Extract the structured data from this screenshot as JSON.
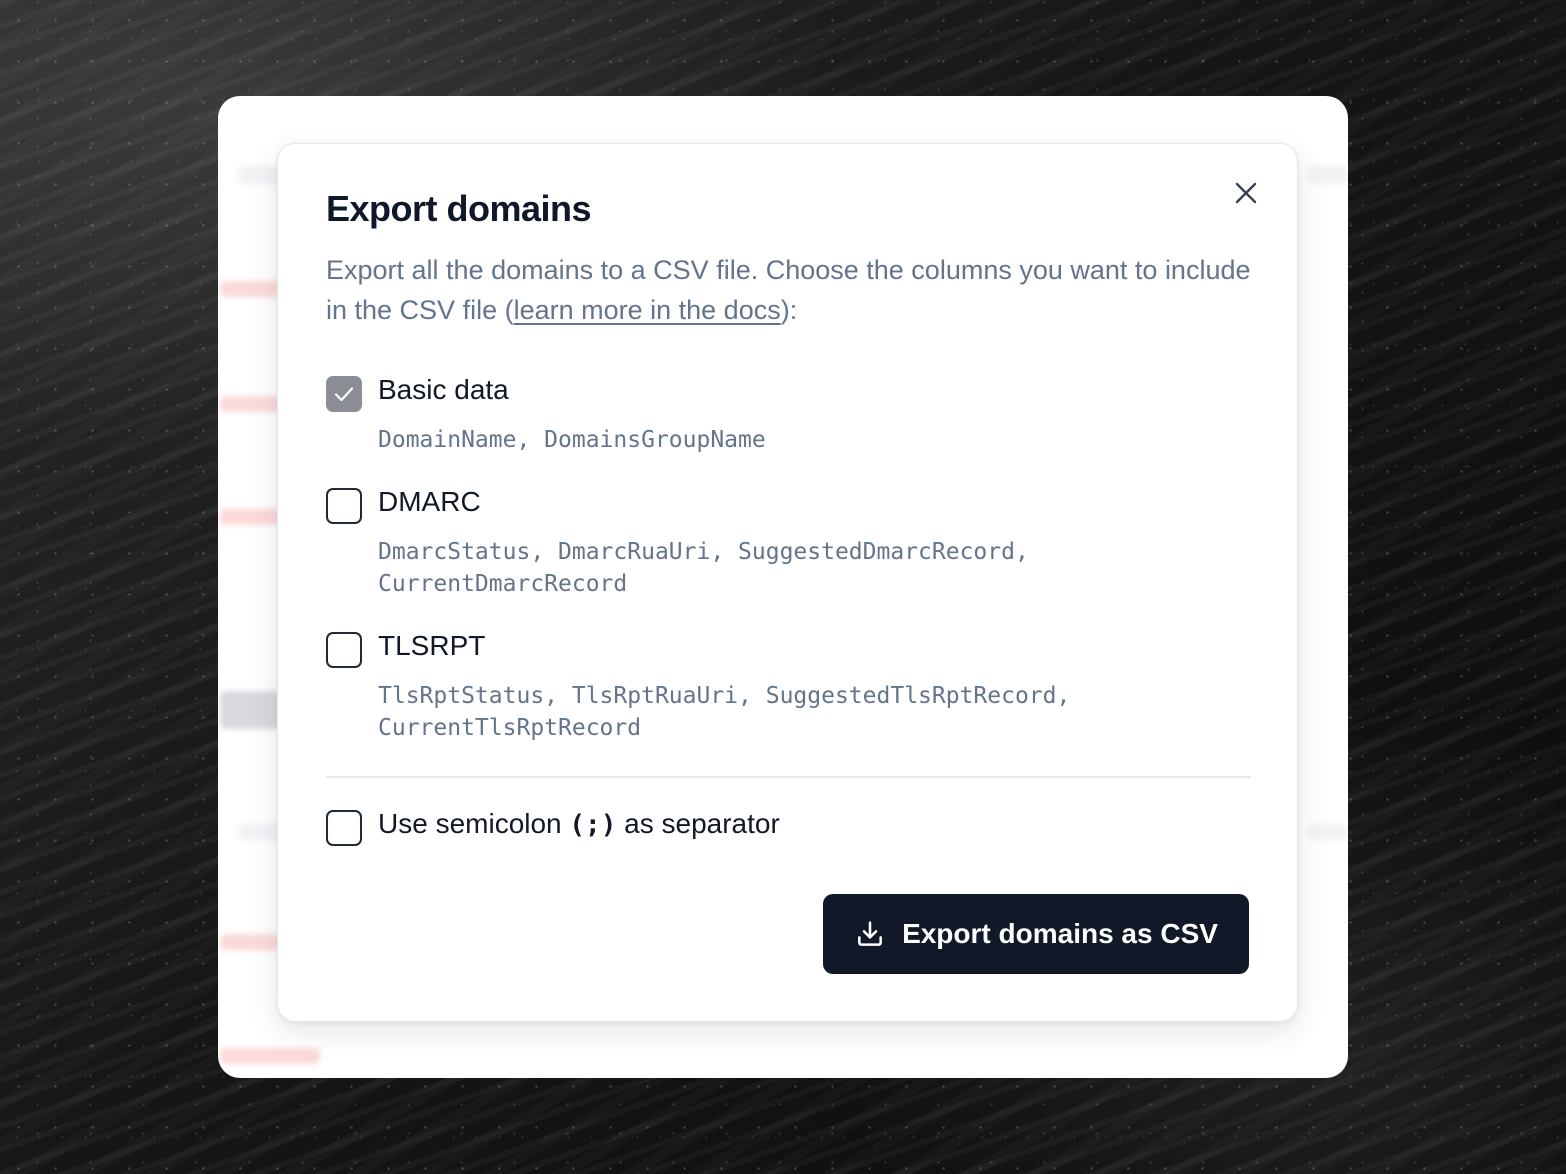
{
  "dialog": {
    "title": "Export domains",
    "description_prefix": "Export all the domains to a CSV file. Choose the columns you want to include in the CSV file (",
    "docs_link": "learn more in the docs",
    "description_suffix": "):",
    "close_icon": "close-icon"
  },
  "options": [
    {
      "label": "Basic data",
      "checked": true,
      "columns": "DomainName, DomainsGroupName"
    },
    {
      "label": "DMARC",
      "checked": false,
      "columns": "DmarcStatus, DmarcRuaUri, SuggestedDmarcRecord, CurrentDmarcRecord"
    },
    {
      "label": "TLSRPT",
      "checked": false,
      "columns": "TlsRptStatus, TlsRptRuaUri, SuggestedTlsRptRecord, CurrentTlsRptRecord"
    }
  ],
  "separator_option": {
    "label_prefix": "Use semicolon ",
    "label_code": "(;)",
    "label_suffix": " as separator",
    "checked": false
  },
  "export_button": {
    "label": "Export domains as CSV",
    "icon": "download-icon"
  },
  "colors": {
    "primary": "#111827",
    "muted_text": "#64748b",
    "checked_box": "#8b8e94"
  }
}
